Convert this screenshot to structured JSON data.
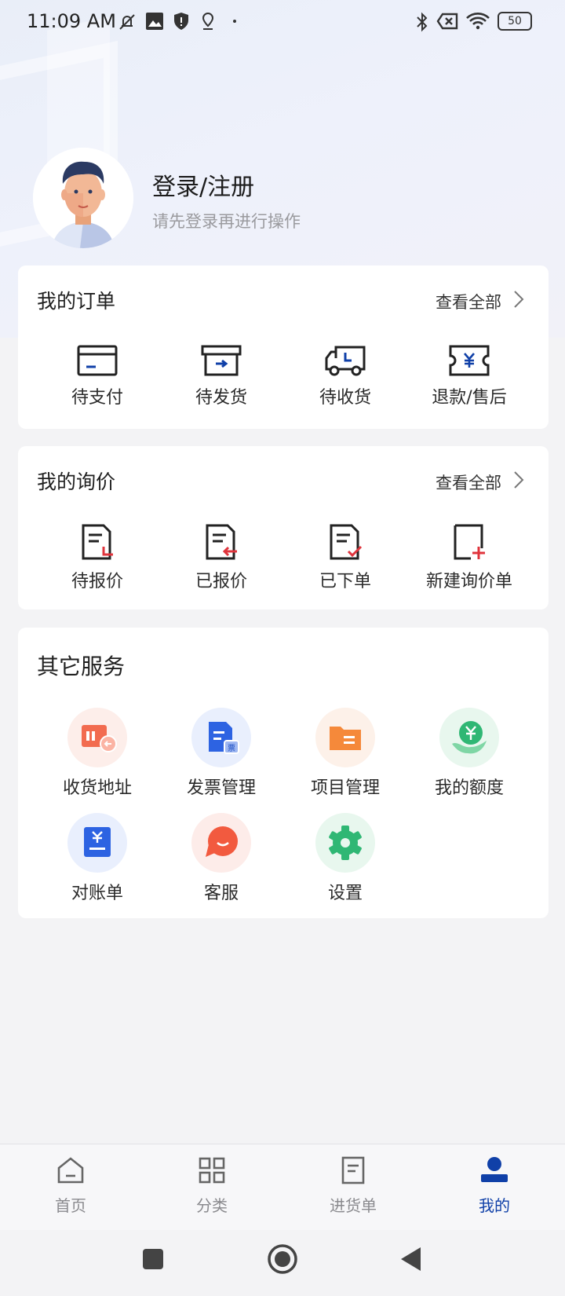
{
  "status_bar": {
    "time": "11:09 AM",
    "battery": "50"
  },
  "profile": {
    "title": "登录/注册",
    "subtitle": "请先登录再进行操作"
  },
  "orders": {
    "title": "我的订单",
    "view_all": "查看全部",
    "items": [
      {
        "label": "待支付",
        "icon": "card-icon"
      },
      {
        "label": "待发货",
        "icon": "box-icon"
      },
      {
        "label": "待收货",
        "icon": "truck-icon"
      },
      {
        "label": "退款/售后",
        "icon": "refund-icon"
      }
    ]
  },
  "inquiry": {
    "title": "我的询价",
    "view_all": "查看全部",
    "items": [
      {
        "label": "待报价",
        "icon": "doc-pending-icon"
      },
      {
        "label": "已报价",
        "icon": "doc-quoted-icon"
      },
      {
        "label": "已下单",
        "icon": "doc-check-icon"
      },
      {
        "label": "新建询价单",
        "icon": "doc-new-icon"
      }
    ]
  },
  "services": {
    "title": "其它服务",
    "items": [
      {
        "label": "收货地址",
        "icon": "address-icon",
        "color": "#f26b4f"
      },
      {
        "label": "发票管理",
        "icon": "invoice-icon",
        "color": "#2d63e2"
      },
      {
        "label": "项目管理",
        "icon": "folder-icon",
        "color": "#f5893a"
      },
      {
        "label": "我的额度",
        "icon": "credit-icon",
        "color": "#2fb774"
      },
      {
        "label": "对账单",
        "icon": "statement-icon",
        "color": "#2d63e2"
      },
      {
        "label": "客服",
        "icon": "chat-icon",
        "color": "#f25a3f"
      },
      {
        "label": "设置",
        "icon": "settings-icon",
        "color": "#2fb774"
      }
    ]
  },
  "bottom_nav": {
    "items": [
      {
        "label": "首页",
        "icon": "home-icon"
      },
      {
        "label": "分类",
        "icon": "grid-icon"
      },
      {
        "label": "进货单",
        "icon": "list-icon"
      },
      {
        "label": "我的",
        "icon": "user-icon"
      }
    ],
    "active_index": 3
  },
  "colors": {
    "accent": "#1040a8",
    "alert_red": "#e0343c"
  }
}
